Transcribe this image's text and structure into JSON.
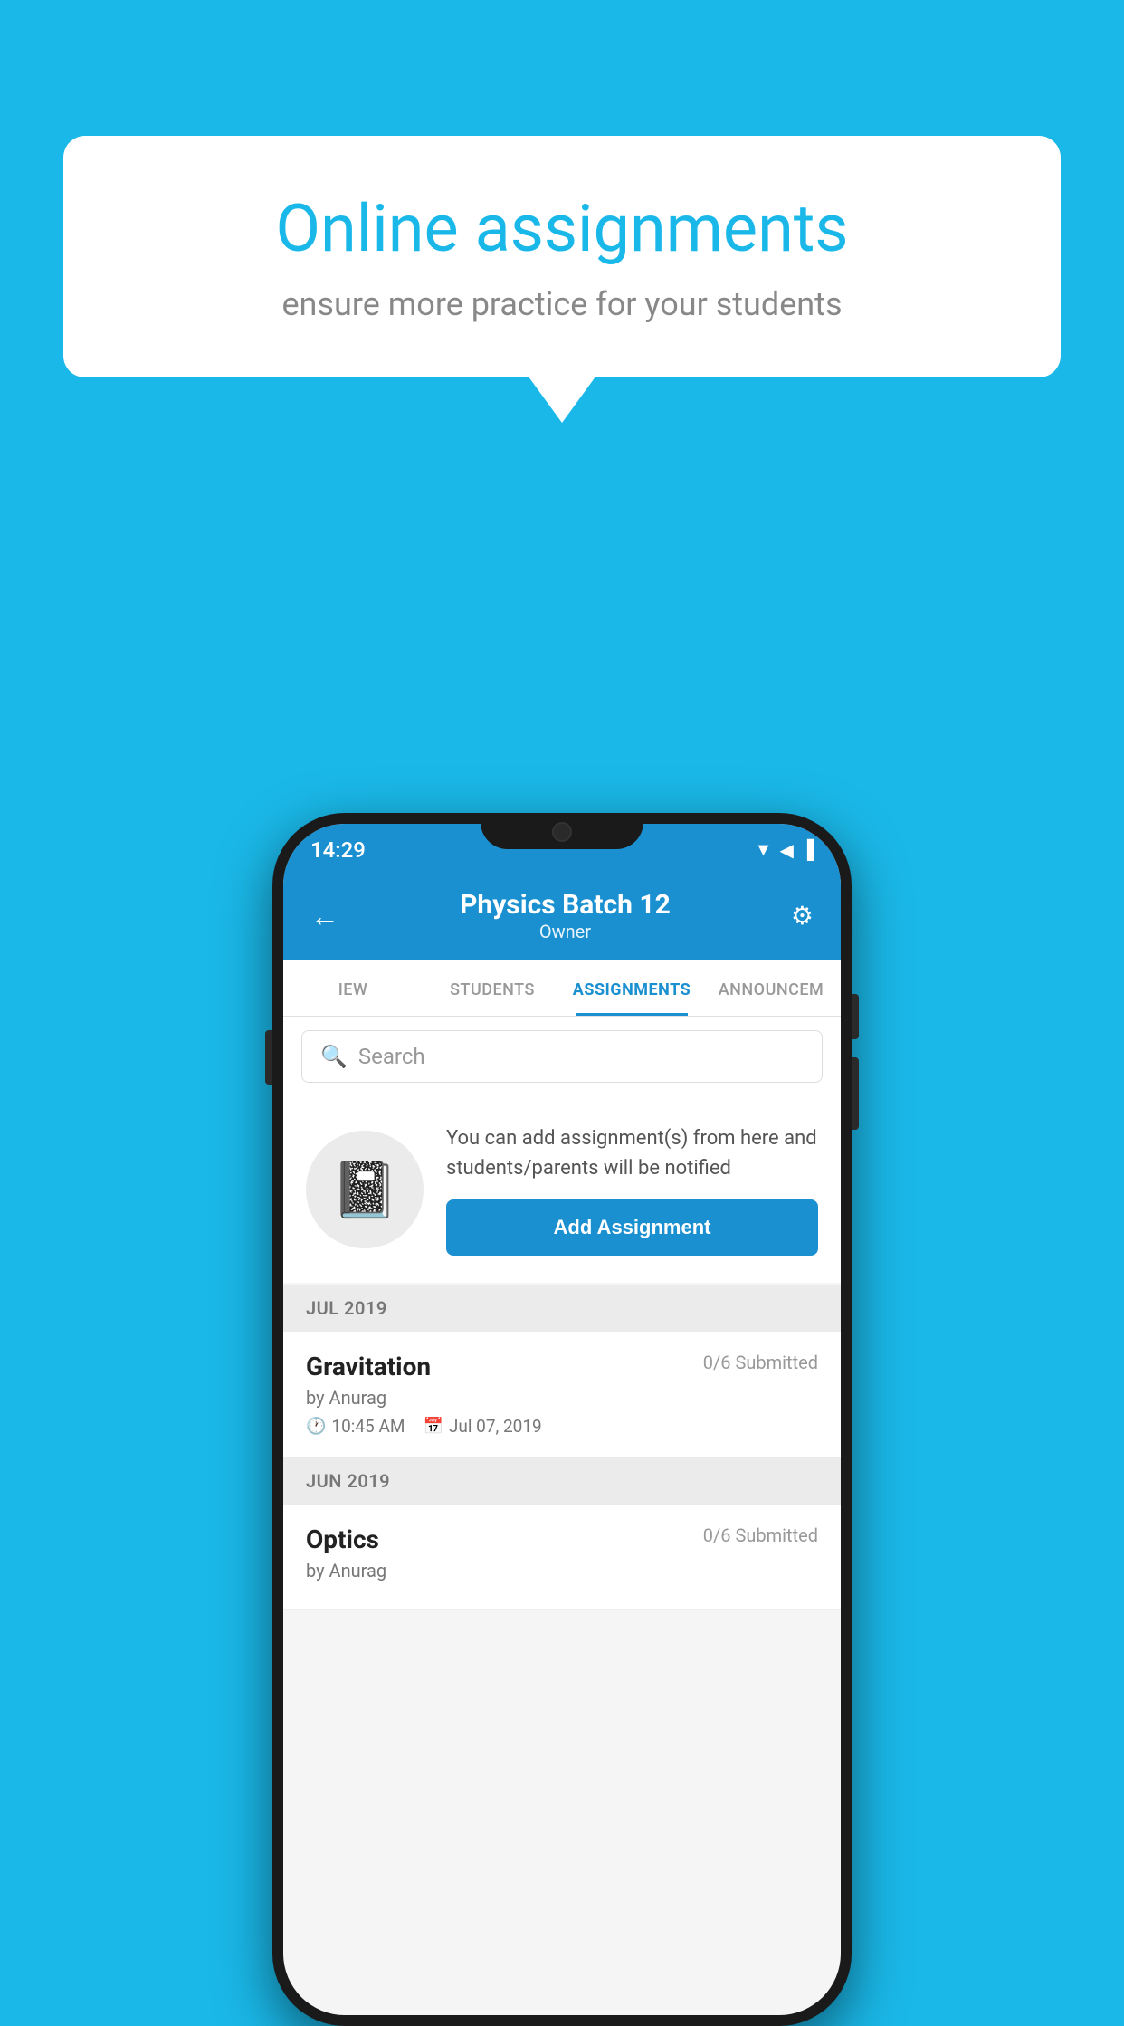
{
  "background_color": "#1ab8e8",
  "speech_bubble": {
    "title": "Online assignments",
    "subtitle": "ensure more practice for your students"
  },
  "phone": {
    "status_bar": {
      "time": "14:29",
      "icons": [
        "wifi",
        "signal",
        "battery"
      ]
    },
    "header": {
      "title": "Physics Batch 12",
      "subtitle": "Owner",
      "back_label": "←",
      "settings_label": "⚙"
    },
    "tabs": [
      {
        "label": "IEW",
        "active": false
      },
      {
        "label": "STUDENTS",
        "active": false
      },
      {
        "label": "ASSIGNMENTS",
        "active": true
      },
      {
        "label": "ANNOUNCEM",
        "active": false
      }
    ],
    "search": {
      "placeholder": "Search"
    },
    "promo": {
      "text": "You can add assignment(s) from here and students/parents will be notified",
      "button_label": "Add Assignment"
    },
    "sections": [
      {
        "header": "JUL 2019",
        "assignments": [
          {
            "title": "Gravitation",
            "submitted": "0/6 Submitted",
            "by": "by Anurag",
            "time": "10:45 AM",
            "date": "Jul 07, 2019"
          }
        ]
      },
      {
        "header": "JUN 2019",
        "assignments": [
          {
            "title": "Optics",
            "submitted": "0/6 Submitted",
            "by": "by Anurag",
            "time": "",
            "date": ""
          }
        ]
      }
    ]
  }
}
